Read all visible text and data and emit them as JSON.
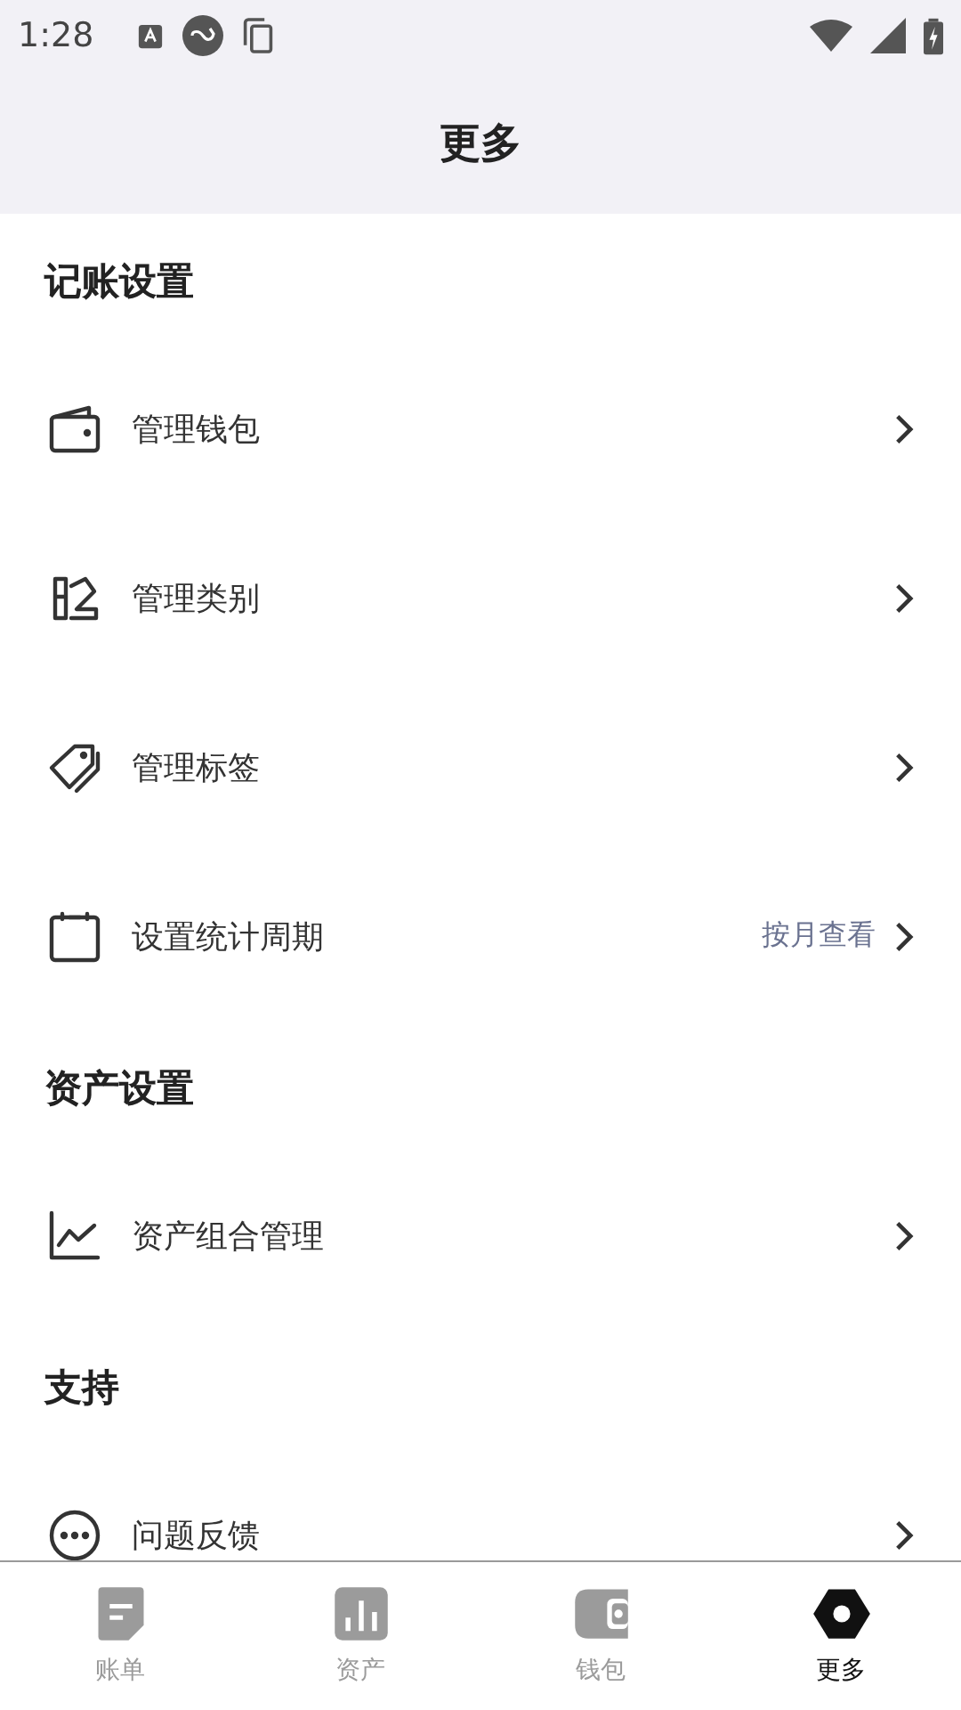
{
  "status_bar": {
    "time": "1:28"
  },
  "header": {
    "title": "更多"
  },
  "sections": [
    {
      "title": "记账设置",
      "items": [
        {
          "kind": "wallet",
          "label": "管理钱包"
        },
        {
          "kind": "category",
          "label": "管理类别"
        },
        {
          "kind": "tag",
          "label": "管理标签"
        },
        {
          "kind": "calendar",
          "label": "设置统计周期",
          "value": "按月查看"
        }
      ]
    },
    {
      "title": "资产设置",
      "items": [
        {
          "kind": "chart",
          "label": "资产组合管理"
        }
      ]
    },
    {
      "title": "支持",
      "items": [
        {
          "kind": "chat",
          "label": "问题反馈"
        }
      ]
    }
  ],
  "tabs": [
    {
      "kind": "bill",
      "label": "账单",
      "selected": false
    },
    {
      "kind": "assets",
      "label": "资产",
      "selected": false
    },
    {
      "kind": "wallet",
      "label": "钱包",
      "selected": false
    },
    {
      "kind": "more",
      "label": "更多",
      "selected": true
    }
  ]
}
